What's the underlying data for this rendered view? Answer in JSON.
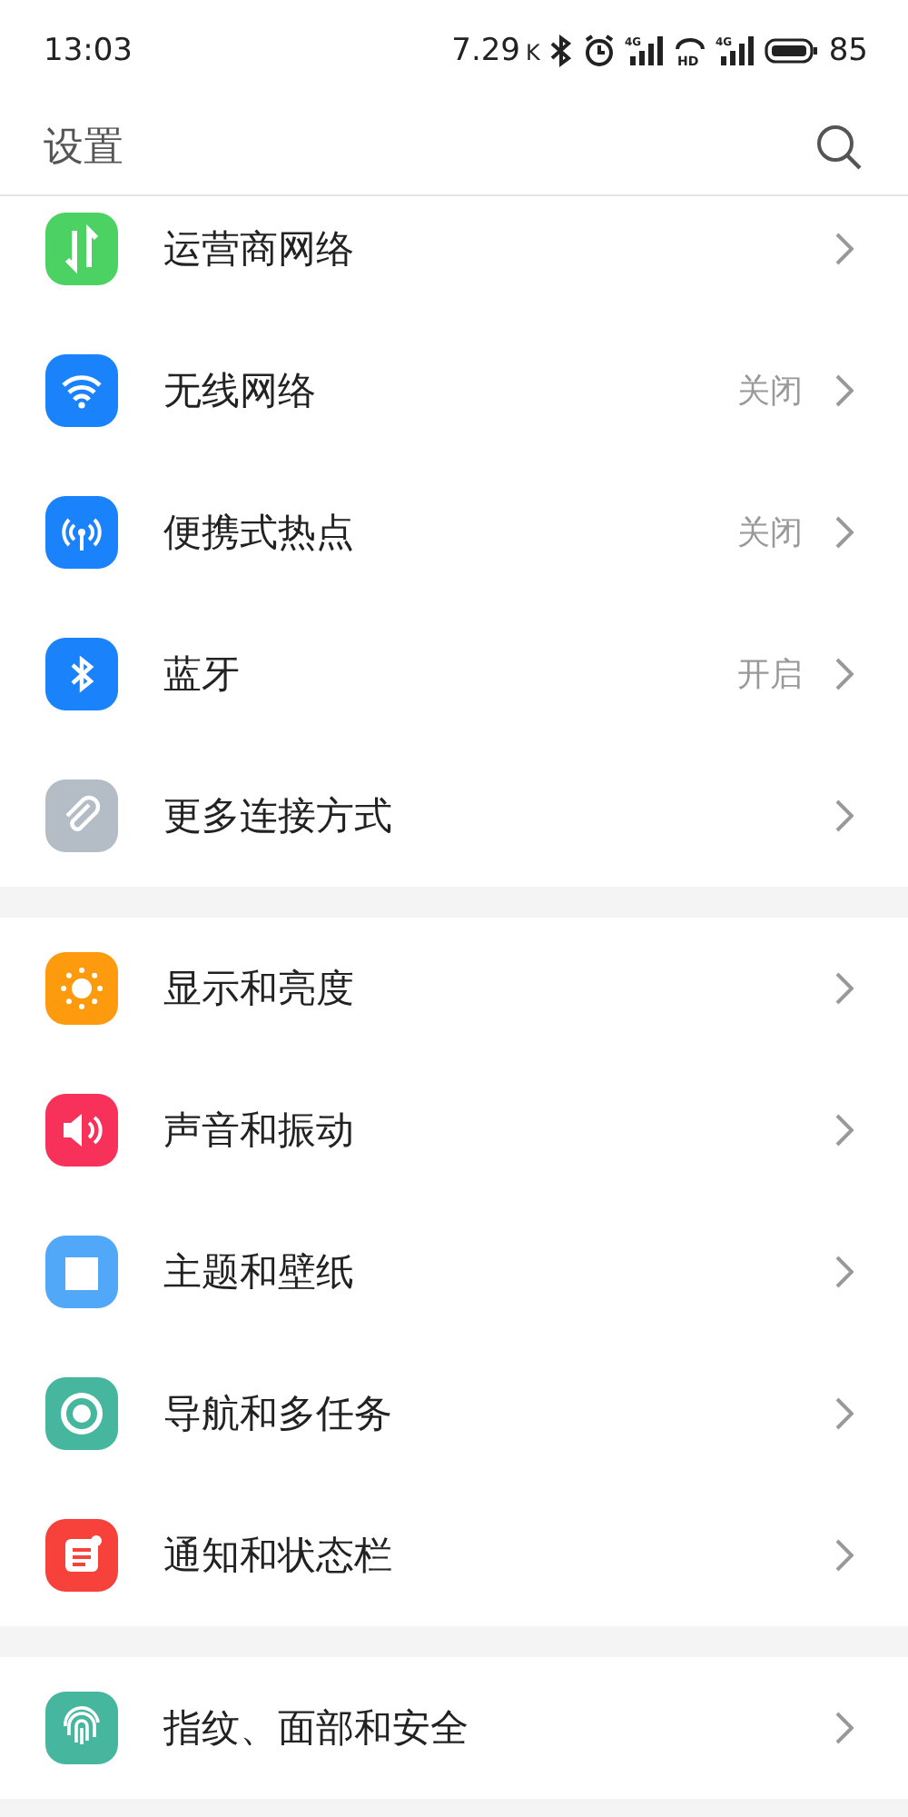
{
  "status_bar": {
    "time": "13:03",
    "speed": "7.29",
    "speed_unit": "K",
    "icons": [
      {
        "kind": "bluetooth"
      },
      {
        "kind": "alarm"
      },
      {
        "kind": "signal",
        "label": "4G"
      },
      {
        "kind": "hd",
        "label": "HD"
      },
      {
        "kind": "signal",
        "label": "4G"
      },
      {
        "kind": "battery"
      }
    ],
    "battery": "85"
  },
  "header": {
    "title": "设置"
  },
  "sections": [
    {
      "items": [
        {
          "kind": "data",
          "color": "#4cd263",
          "label": "运营商网络"
        },
        {
          "kind": "wifi",
          "color": "#1a82fb",
          "label": "无线网络",
          "value": "关闭"
        },
        {
          "kind": "hotspot",
          "color": "#1a82fb",
          "label": "便携式热点",
          "value": "关闭"
        },
        {
          "kind": "bluetooth",
          "color": "#1a82fb",
          "label": "蓝牙",
          "value": "开启"
        },
        {
          "kind": "clip",
          "color": "#b4bcc6",
          "label": "更多连接方式"
        }
      ]
    },
    {
      "items": [
        {
          "kind": "sun",
          "color": "#fd9a0e",
          "label": "显示和亮度"
        },
        {
          "kind": "sound",
          "color": "#f8315a",
          "label": "声音和振动"
        },
        {
          "kind": "shirt",
          "color": "#51a8f8",
          "label": "主题和壁纸"
        },
        {
          "kind": "ring",
          "color": "#46b69e",
          "label": "导航和多任务"
        },
        {
          "kind": "note",
          "color": "#f6423b",
          "label": "通知和状态栏"
        }
      ]
    },
    {
      "items": [
        {
          "kind": "finger",
          "color": "#46b69e",
          "label": "指纹、面部和安全"
        }
      ]
    }
  ]
}
